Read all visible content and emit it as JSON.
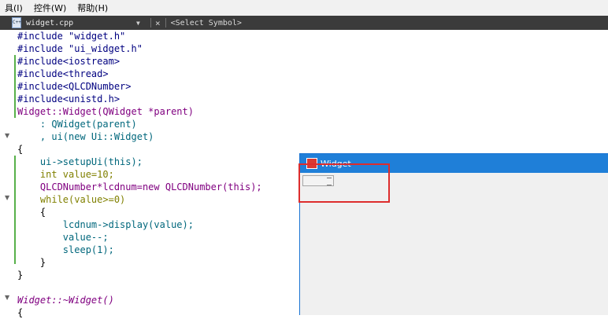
{
  "menu": [
    "具(I)",
    "控件(W)",
    "帮助(H)"
  ],
  "tab": {
    "file": "widget.cpp",
    "symbol": "<Select Symbol>"
  },
  "code": [
    "#include \"widget.h\"",
    "#include \"ui_widget.h\"",
    "#include<iostream>",
    "#include<thread>",
    "#include<QLCDNumber>",
    "#include<unistd.h>",
    "Widget::Widget(QWidget *parent)",
    "    : QWidget(parent)",
    "    , ui(new Ui::Widget)",
    "{",
    "    ui->setupUi(this);",
    "    int value=10;",
    "    QLCDNumber*lcdnum=new QLCDNumber(this);",
    "    while(value>=0)",
    "    {",
    "        lcdnum->display(value);",
    "        value--;",
    "        sleep(1);",
    "    }",
    "}",
    "",
    "Widget::~Widget()",
    "{"
  ],
  "window": {
    "title": "Widget",
    "lcd_value": ""
  },
  "colors": {
    "accent_blue": "#1f7fd8",
    "highlight_red": "#dd2d2d",
    "marker_green": "#58b14a"
  }
}
